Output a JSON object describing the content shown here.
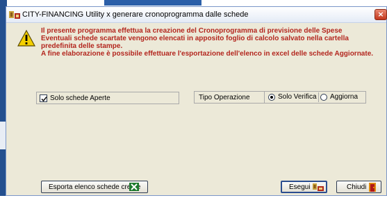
{
  "window": {
    "title": "CITY-FINANCING  Utility x  generare cronoprogramma dalle schede",
    "close_glyph": "×"
  },
  "message": {
    "lines": [
      "Il presente programma effettua la creazione del Cronoprogramma di previsione delle Spese",
      "Eventuali schede scartate vengono elencati in apposito foglio di calcolo salvato nella cartella predefinita delle stampe.",
      "A fine elaborazione è possibile effettuare l'esportazione dell'elenco in excel delle schede Aggiornate."
    ],
    "color": "#b3261e",
    "icon": "warning-icon"
  },
  "filters": {
    "solo_aperte_label": "Solo schede Aperte",
    "solo_aperte_checked": true
  },
  "operation": {
    "label": "Tipo Operazione",
    "options": [
      {
        "label": "Solo Verifica",
        "selected": true
      },
      {
        "label": "Aggiorna",
        "selected": false
      }
    ]
  },
  "buttons": {
    "esporta_label": "Esporta elenco schede create",
    "esporta_icon": "excel-icon",
    "esegui_label": "Esegui",
    "esegui_icon": "run-icon",
    "chiudi_label": "Chiudi",
    "chiudi_icon": "exit-door-icon"
  }
}
